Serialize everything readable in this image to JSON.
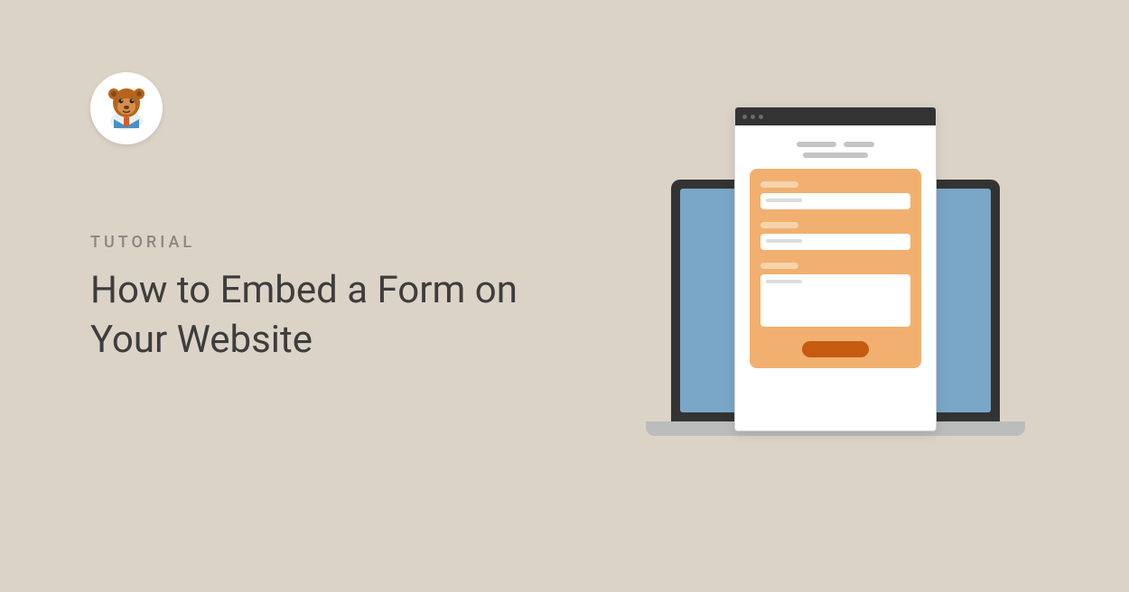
{
  "category": "TUTORIAL",
  "title": "How to Embed a Form on Your Website",
  "logo": {
    "name": "wpforms-bear-mascot"
  },
  "colors": {
    "background": "#dcd3c7",
    "titleText": "#3d3d3d",
    "categoryText": "#8a8680",
    "laptopScreen": "#7aa7c7",
    "formCard": "#f1b06f",
    "formButton": "#c65a11"
  }
}
